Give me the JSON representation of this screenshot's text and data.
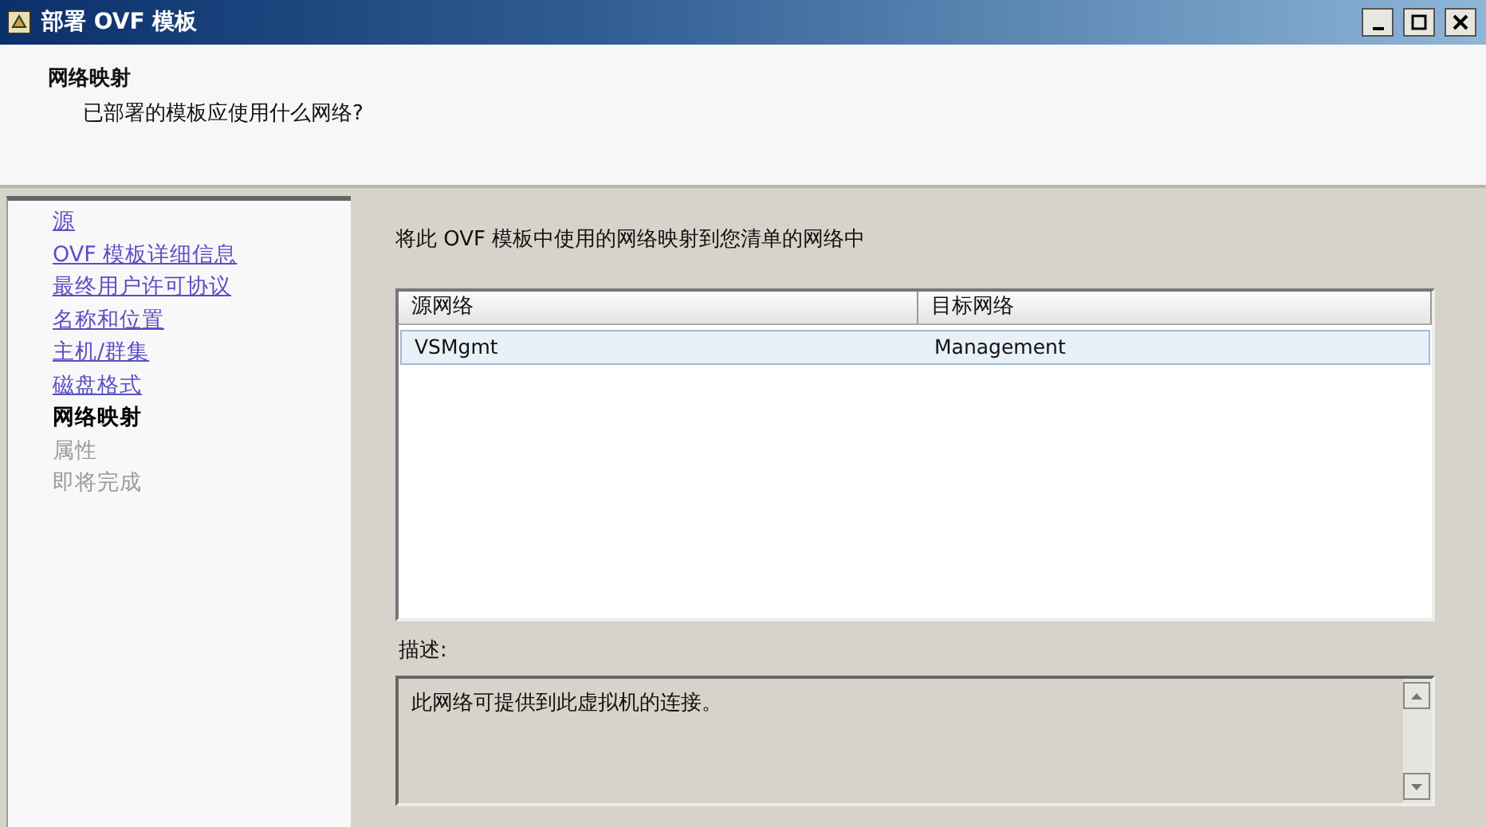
{
  "window": {
    "title": "部署 OVF 模板"
  },
  "header": {
    "title": "网络映射",
    "subtitle": "已部署的模板应使用什么网络?"
  },
  "steps": [
    {
      "label": "源",
      "kind": "done"
    },
    {
      "label": "OVF 模板详细信息",
      "kind": "done"
    },
    {
      "label": "最终用户许可协议",
      "kind": "done"
    },
    {
      "label": "名称和位置",
      "kind": "done"
    },
    {
      "label": "主机/群集",
      "kind": "done"
    },
    {
      "label": "磁盘格式",
      "kind": "done"
    },
    {
      "label": "网络映射",
      "kind": "current"
    },
    {
      "label": "属性",
      "kind": "pending"
    },
    {
      "label": "即将完成",
      "kind": "pending"
    }
  ],
  "instruction": "将此 OVF 模板中使用的网络映射到您清单的网络中",
  "table": {
    "columns": [
      "源网络",
      "目标网络"
    ],
    "rows": [
      {
        "cells": [
          "VSMgmt",
          "Management"
        ],
        "selected": true
      }
    ]
  },
  "description": {
    "label": "描述:",
    "text": "此网络可提供到此虚拟机的连接。"
  }
}
